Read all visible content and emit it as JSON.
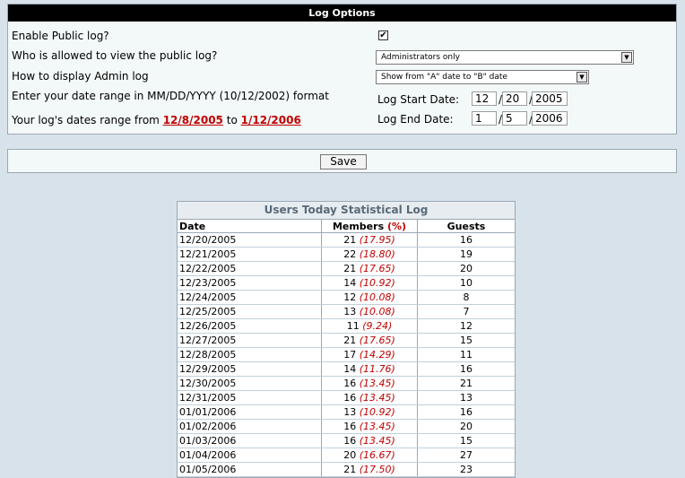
{
  "options": {
    "title": "Log Options",
    "enable_public_label": "Enable Public log?",
    "enable_public_checked": true,
    "who_allowed_label": "Who is allowed to view the public log?",
    "who_allowed_value": "Administrators only",
    "display_admin_label": "How to display Admin log",
    "display_admin_value": "Show from \"A\" date to \"B\" date",
    "date_format_label": "Enter your date range in MM/DD/YYYY (10/12/2002) format",
    "range_prefix": "Your log's dates range from",
    "range_start": "12/8/2005",
    "range_to": "to",
    "range_end": "1/12/2006",
    "start_date_label": "Log Start Date:",
    "start_month": "12",
    "start_day": "20",
    "start_year": "2005",
    "end_date_label": "Log End Date:",
    "end_month": "1",
    "end_day": "5",
    "end_year": "2006"
  },
  "save_label": "Save",
  "stats": {
    "title": "Users Today Statistical Log",
    "col_date": "Date",
    "col_members": "Members",
    "col_members_pct": "(%)",
    "col_guests": "Guests",
    "rows": [
      {
        "date": "12/20/2005",
        "members": "21",
        "pct": "(17.95)",
        "guests": "16"
      },
      {
        "date": "12/21/2005",
        "members": "22",
        "pct": "(18.80)",
        "guests": "19"
      },
      {
        "date": "12/22/2005",
        "members": "21",
        "pct": "(17.65)",
        "guests": "20"
      },
      {
        "date": "12/23/2005",
        "members": "14",
        "pct": "(10.92)",
        "guests": "10"
      },
      {
        "date": "12/24/2005",
        "members": "12",
        "pct": "(10.08)",
        "guests": "8"
      },
      {
        "date": "12/25/2005",
        "members": "13",
        "pct": "(10.08)",
        "guests": "7"
      },
      {
        "date": "12/26/2005",
        "members": "11",
        "pct": "(9.24)",
        "guests": "12"
      },
      {
        "date": "12/27/2005",
        "members": "21",
        "pct": "(17.65)",
        "guests": "15"
      },
      {
        "date": "12/28/2005",
        "members": "17",
        "pct": "(14.29)",
        "guests": "11"
      },
      {
        "date": "12/29/2005",
        "members": "14",
        "pct": "(11.76)",
        "guests": "16"
      },
      {
        "date": "12/30/2005",
        "members": "16",
        "pct": "(13.45)",
        "guests": "21"
      },
      {
        "date": "12/31/2005",
        "members": "16",
        "pct": "(13.45)",
        "guests": "13"
      },
      {
        "date": "01/01/2006",
        "members": "13",
        "pct": "(10.92)",
        "guests": "16"
      },
      {
        "date": "01/02/2006",
        "members": "16",
        "pct": "(13.45)",
        "guests": "20"
      },
      {
        "date": "01/03/2006",
        "members": "16",
        "pct": "(13.45)",
        "guests": "15"
      },
      {
        "date": "01/04/2006",
        "members": "20",
        "pct": "(16.67)",
        "guests": "27"
      },
      {
        "date": "01/05/2006",
        "members": "21",
        "pct": "(17.50)",
        "guests": "23"
      }
    ]
  }
}
